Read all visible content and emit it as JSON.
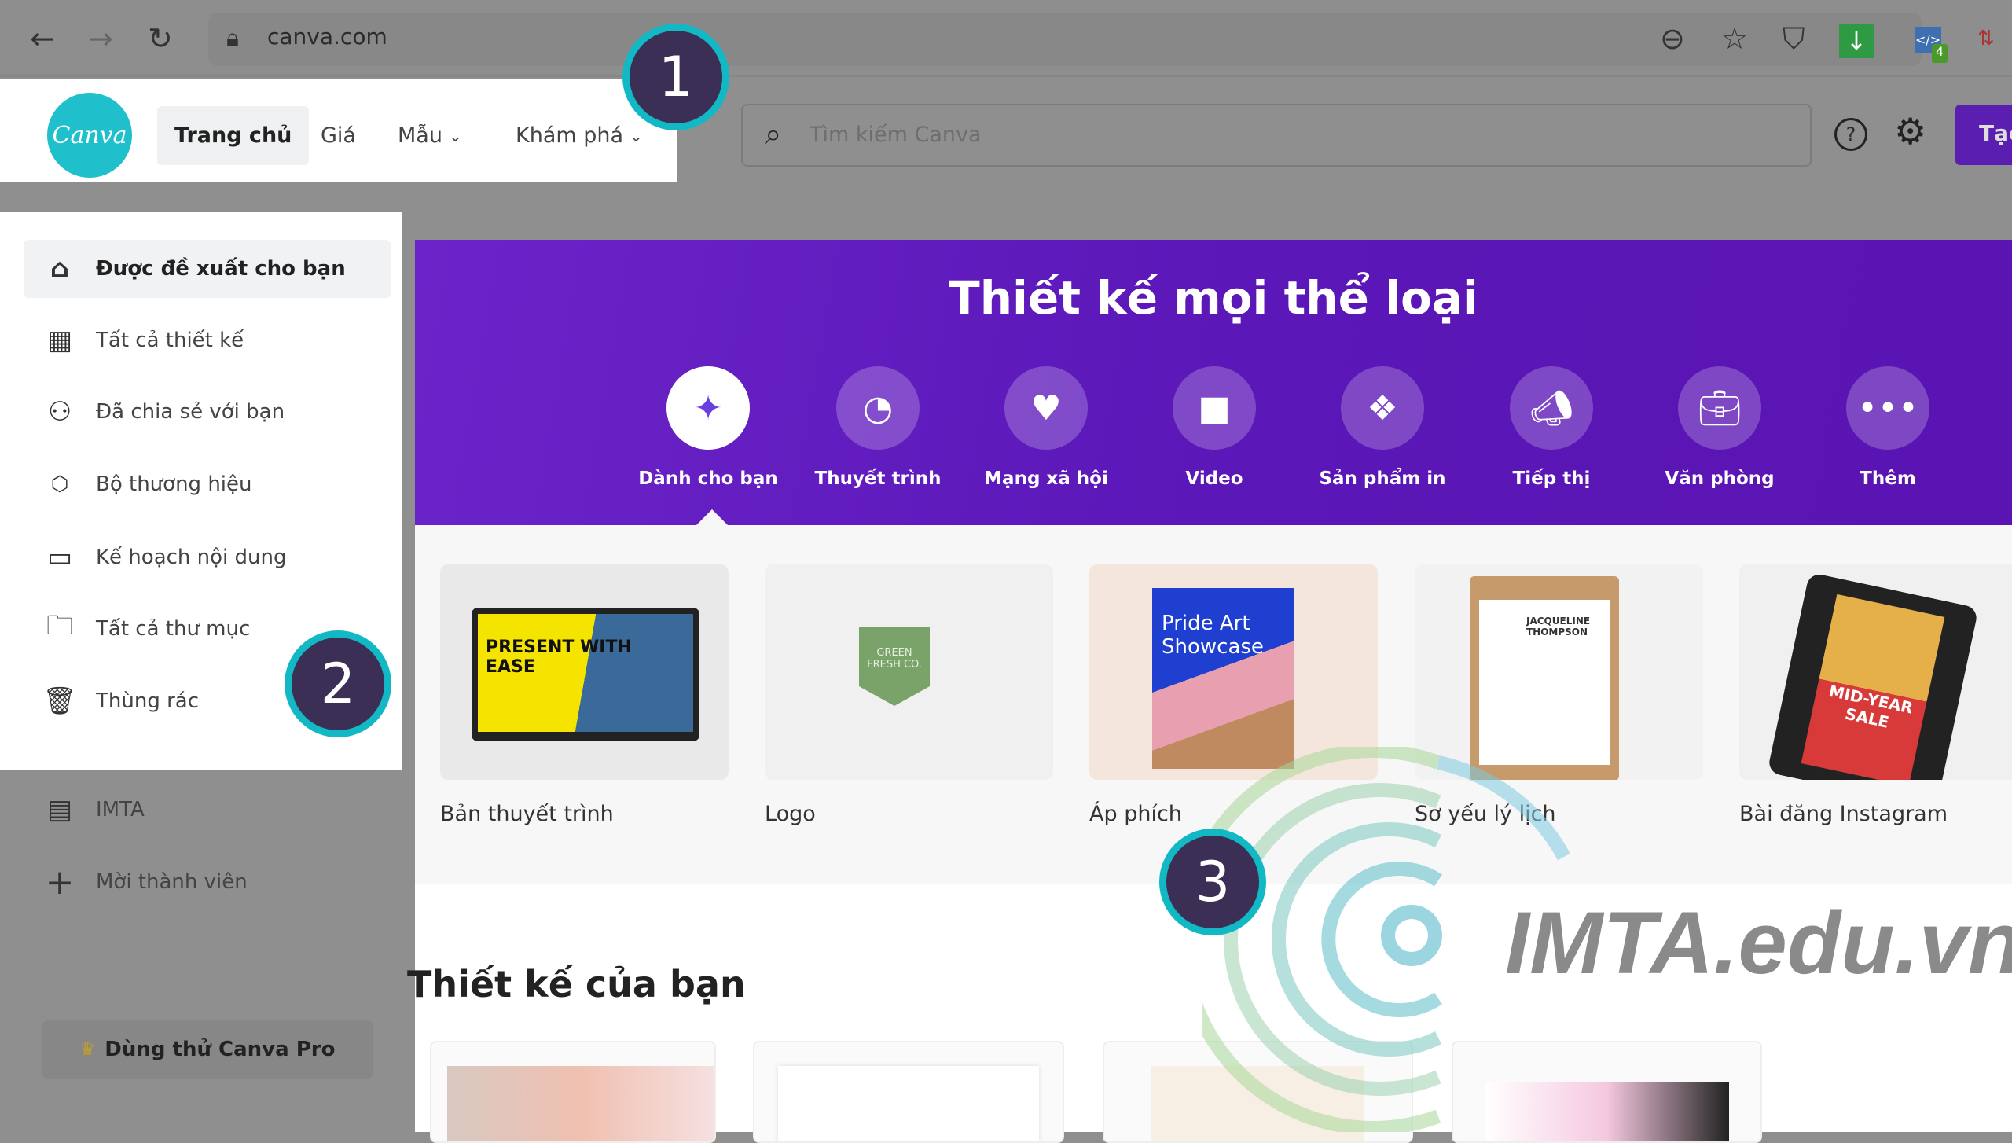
{
  "browser": {
    "url": "canva.com",
    "extension_badge": "4"
  },
  "header": {
    "logo": "Canva",
    "nav": [
      {
        "label": "Trang chủ"
      },
      {
        "label": "Giá"
      },
      {
        "label": "Mẫu"
      },
      {
        "label": "Khám phá"
      }
    ],
    "search_placeholder": "Tìm kiếm Canva",
    "create_label": "Tạo"
  },
  "sidebar": {
    "items": [
      {
        "label": "Được đề xuất cho bạn",
        "icon": "home-icon"
      },
      {
        "label": "Tất cả thiết kế",
        "icon": "grid-icon"
      },
      {
        "label": "Đã chia sẻ với bạn",
        "icon": "shared-users-icon"
      },
      {
        "label": "Bộ thương hiệu",
        "icon": "brand-kit-icon"
      },
      {
        "label": "Kế hoạch nội dung",
        "icon": "calendar-icon"
      },
      {
        "label": "Tất cả thư mục",
        "icon": "folder-icon"
      },
      {
        "label": "Thùng rác",
        "icon": "trash-icon"
      }
    ],
    "team": {
      "label": "IMTA"
    },
    "invite": {
      "label": "Mời thành viên"
    },
    "pro_label": "Dùng thử Canva Pro"
  },
  "banner": {
    "title": "Thiết kế mọi thể loại",
    "categories": [
      {
        "label": "Dành cho bạn",
        "icon": "sparkle-icon"
      },
      {
        "label": "Thuyết trình",
        "icon": "presentation-icon"
      },
      {
        "label": "Mạng xã hội",
        "icon": "social-heart-icon"
      },
      {
        "label": "Video",
        "icon": "video-camera-icon"
      },
      {
        "label": "Sản phẩm in",
        "icon": "print-icon"
      },
      {
        "label": "Tiếp thị",
        "icon": "megaphone-icon"
      },
      {
        "label": "Văn phòng",
        "icon": "briefcase-icon"
      },
      {
        "label": "Thêm",
        "icon": "more-icon"
      }
    ]
  },
  "templates": [
    {
      "label": "Bản thuyết trình",
      "thumb": "PRESENT WITH EASE"
    },
    {
      "label": "Logo",
      "thumb": "GREEN FRESH CO."
    },
    {
      "label": "Áp phích",
      "thumb": "Pride Art Showcase"
    },
    {
      "label": "Sơ yếu lý lịch",
      "thumb": "JACQUELINE THOMPSON"
    },
    {
      "label": "Bài đăng Instagram",
      "thumb": "MID-YEAR SALE"
    }
  ],
  "your_designs": {
    "title": "Thiết kế của bạn"
  },
  "annotations": [
    "1",
    "2",
    "3"
  ],
  "watermark": "IMTA.edu.vn",
  "colors": {
    "brand_teal": "#1fc0cc",
    "banner_purple": "#6b24c9",
    "badge_fill": "#3b2f55",
    "badge_ring": "#12b8c4"
  }
}
